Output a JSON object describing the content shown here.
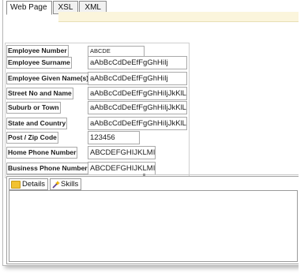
{
  "tabs": [
    "Web Page",
    "XSL",
    "XML"
  ],
  "fields": [
    {
      "label": "Employee Number",
      "value": "ABCDE"
    },
    {
      "label": "Employee Surname",
      "value": "aAbBcCdDeEfFgGhHiIj"
    },
    {
      "label": "Employee Given Name(s)",
      "value": "aAbBcCdDeEfFgGhHiIj"
    },
    {
      "label": "Street No and Name",
      "value": "aAbBcCdDeEfFgGhHiIjJkKlL"
    },
    {
      "label": "Suburb or Town",
      "value": "aAbBcCdDeEfFgGhHiIjJkKlL"
    },
    {
      "label": "State and Country",
      "value": "aAbBcCdDeEfFgGhHiIjJkKlL"
    },
    {
      "label": "Post / Zip Code",
      "value": "123456"
    },
    {
      "label": "Home Phone Number",
      "value": "ABCDEFGHIJKLMI"
    },
    {
      "label": "Business Phone Number",
      "value": "ABCDEFGHIJKLMI"
    }
  ],
  "detail_tabs": [
    "Details",
    "Skills"
  ]
}
